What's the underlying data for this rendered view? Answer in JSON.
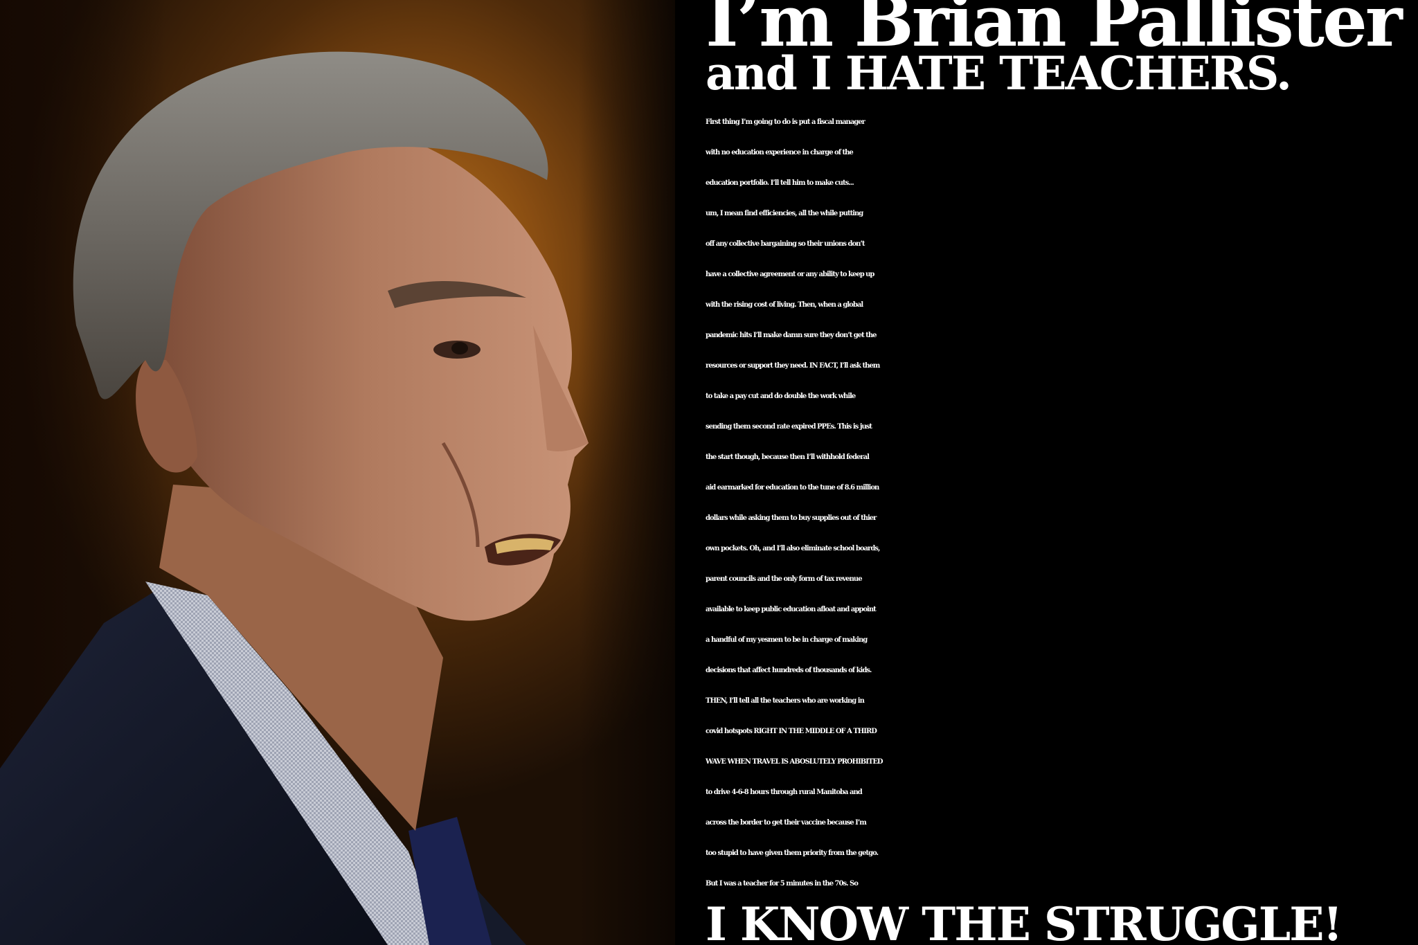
{
  "headline": {
    "line1": "I’m Brian Pallister",
    "line2": "and I HATE TEACHERS."
  },
  "body_lines": [
    "First thing I’m going to do is put a fiscal manager",
    "with no education experience in charge of the",
    "education portfolio. I’ll tell him to make cuts...",
    "um, I mean find efficiencies, all the while putting",
    "off any collective bargaining so their unions don’t",
    "have a collective agreement or any ability to keep up",
    "with the rising cost of living. Then, when a global",
    "pandemic hits I’ll make damn sure they don’t get the",
    "resources or support they need. IN FACT, I’ll ask them",
    "to take a pay cut and do double the work while",
    "sending them second rate expired PPEs. This is just",
    "the start though, because then I’ll withhold federal",
    "aid earmarked for education to the tune of 8.6 million",
    "dollars while asking them to buy supplies out of thier",
    "own pockets. Oh, and I’ll also eliminate school boards,",
    "parent councils and the only form of tax revenue",
    "available to keep public education afloat and appoint",
    "a handful of my yesmen to be in charge of making",
    "decisions that affect hundreds of thousands of kids.",
    "THEN,  I’ll tell all the teachers who are working in",
    "covid hotspots RIGHT IN THE MIDDLE OF A THIRD",
    "WAVE WHEN TRAVEL IS ABOSLUTELY PROHIBITED",
    "to drive 4-6-8  hours through rural Manitoba and",
    "across the border to get their vaccine because I’m",
    "too stupid to have given them priority from the getgo.",
    "But I was a teacher for 5 minutes in the 70s. So"
  ],
  "closer": "I KNOW THE STRUGGLE!",
  "colors": {
    "text": "#ffffff",
    "panel_background": "#000000",
    "photo_backdrop": "#8a4e12"
  }
}
